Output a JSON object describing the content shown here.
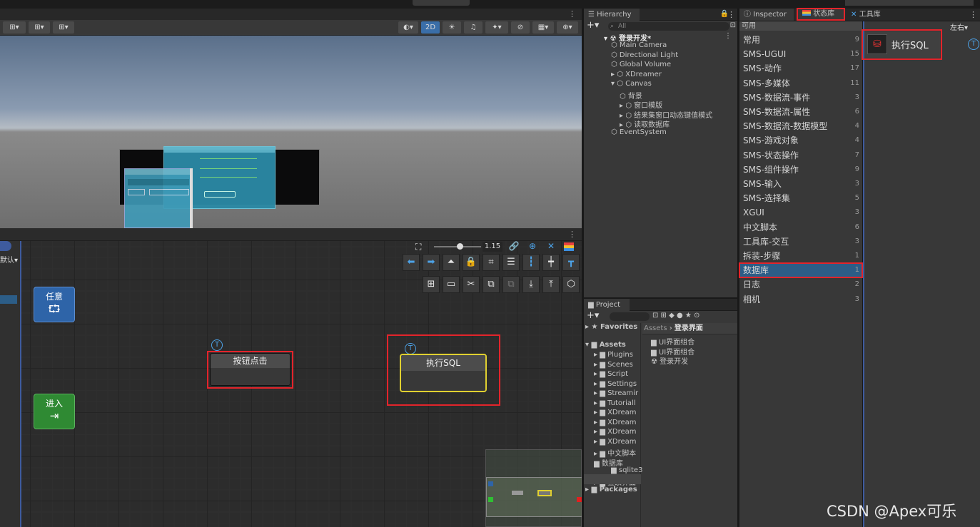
{
  "scene_toolbar": {
    "left_tools": [
      "⊞",
      "⊞",
      "⊞"
    ],
    "mode_2d": "2D",
    "right_tools": [
      "○",
      "2D",
      "💡",
      "🔊",
      "✦",
      "⊘",
      "▦",
      "⊕"
    ]
  },
  "graph": {
    "zoom_value": "1.15",
    "side_label": "默认",
    "nodes": {
      "any": "任意",
      "enter": "进入",
      "button_click": "按钮点击",
      "exec_sql": "执行SQL"
    },
    "badge_letter": "T"
  },
  "hierarchy": {
    "tab_label": "Hierarchy",
    "add_label": "+",
    "search_placeholder": "All",
    "scene_name": "登录开发*",
    "items": [
      {
        "label": "Main Camera",
        "indent": 1
      },
      {
        "label": "Directional Light",
        "indent": 1
      },
      {
        "label": "Global Volume",
        "indent": 1
      },
      {
        "label": "XDreamer",
        "indent": 1
      },
      {
        "label": "Canvas",
        "indent": 1
      },
      {
        "label": "背景",
        "indent": 2
      },
      {
        "label": "窗口模版",
        "indent": 2
      },
      {
        "label": "结果集窗口动态键值模式",
        "indent": 2
      },
      {
        "label": "读取数据库",
        "indent": 2
      },
      {
        "label": "EventSystem",
        "indent": 1
      }
    ]
  },
  "project": {
    "tab_label": "Project",
    "breadcrumb": [
      "Assets",
      "登录界面"
    ],
    "favorites_label": "Favorites",
    "assets_label": "Assets",
    "packages_label": "Packages",
    "folders": [
      "Plugins",
      "Scenes",
      "Script",
      "Settings",
      "Streamir",
      "Tutoriall",
      "XDream",
      "XDream",
      "XDream",
      "XDream",
      "中文脚本",
      "数据库",
      "sqlite3",
      "登录界面"
    ],
    "files": [
      "UI界面组合",
      "UI界面组合",
      "登录开发"
    ]
  },
  "inspector_tabs": {
    "inspector": "Inspector",
    "state_lib": "状态库",
    "tool_lib": "工具库"
  },
  "state_lib": {
    "available_label": "可用",
    "position_label": "左右",
    "categories": [
      {
        "name": "常用",
        "count": "9"
      },
      {
        "name": "SMS-UGUI",
        "count": "15"
      },
      {
        "name": "SMS-动作",
        "count": "17"
      },
      {
        "name": "SMS-多媒体",
        "count": "11"
      },
      {
        "name": "SMS-数据流-事件",
        "count": "3"
      },
      {
        "name": "SMS-数据流-属性",
        "count": "6"
      },
      {
        "name": "SMS-数据流-数据模型",
        "count": "4"
      },
      {
        "name": "SMS-游戏对象",
        "count": "4"
      },
      {
        "name": "SMS-状态操作",
        "count": "7"
      },
      {
        "name": "SMS-组件操作",
        "count": "9"
      },
      {
        "name": "SMS-输入",
        "count": "3"
      },
      {
        "name": "SMS-选择集",
        "count": "5"
      },
      {
        "name": "XGUI",
        "count": "3"
      },
      {
        "name": "中文脚本",
        "count": "6"
      },
      {
        "name": "工具库-交互",
        "count": "3"
      },
      {
        "name": "拆装-步骤",
        "count": "1"
      },
      {
        "name": "数据库",
        "count": "1"
      },
      {
        "name": "日志",
        "count": "2"
      },
      {
        "name": "相机",
        "count": "3"
      }
    ],
    "selected_index": 16,
    "result_item": "执行SQL"
  },
  "watermark": "CSDN @Apex可乐",
  "colors": {
    "highlight_red": "#e3242b",
    "selection_blue": "#2c5d87",
    "node_yellow": "#e0d030",
    "any_node_blue": "#2e64a8",
    "enter_node_green": "#2f8a33"
  }
}
